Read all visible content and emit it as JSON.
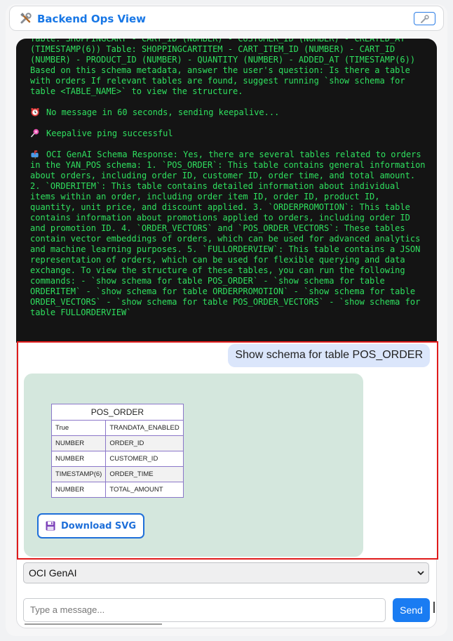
{
  "header": {
    "title": "Backend Ops View",
    "icon": "tools-icon",
    "action_icon": "wrench-icon"
  },
  "terminal": {
    "messages": [
      {
        "icon": "",
        "text": "Table: SHOPPINGCART - CART_ID (NUMBER) - CUSTOMER_ID (NUMBER) - CREATED_AT (TIMESTAMP(6)) Table: SHOPPINGCARTITEM - CART_ITEM_ID (NUMBER) - CART_ID (NUMBER) - PRODUCT_ID (NUMBER) - QUANTITY (NUMBER) - ADDED_AT (TIMESTAMP(6)) Based on this schema metadata, answer the user's question: Is there a table with orders If relevant tables are found, suggest running `show schema for table <TABLE_NAME>` to view the structure."
      },
      {
        "icon": "alarm-clock-icon",
        "text": "No message in 60 seconds, sending keepalive..."
      },
      {
        "icon": "lollipop-icon",
        "text": "Keepalive ping successful"
      },
      {
        "icon": "mailbox-icon",
        "text": "OCI GenAI Schema Response: Yes, there are several tables related to orders in the YAN_POS schema: 1. `POS_ORDER`: This table contains general information about orders, including order ID, customer ID, order time, and total amount. 2. `ORDERITEM`: This table contains detailed information about individual items within an order, including order item ID, order ID, product ID, quantity, unit price, and discount applied. 3. `ORDERPROMOTION`: This table contains information about promotions applied to orders, including order ID and promotion ID. 4. `ORDER_VECTORS` and `POS_ORDER_VECTORS`: These tables contain vector embeddings of orders, which can be used for advanced analytics and machine learning purposes. 5. `FULLORDERVIEW`: This table contains a JSON representation of orders, which can be used for flexible querying and data exchange. To view the structure of these tables, you can run the following commands: - `show schema for table POS_ORDER` - `show schema for table ORDERITEM` - `show schema for table ORDERPROMOTION` - `show schema for table ORDER_VECTORS` - `show schema for table POS_ORDER_VECTORS` - `show schema for table FULLORDERVIEW`"
      }
    ]
  },
  "chat": {
    "user_message": "Show schema for table POS_ORDER",
    "schema": {
      "table_name": "POS_ORDER",
      "rows": [
        {
          "type": "True",
          "name": "TRANDATA_ENABLED"
        },
        {
          "type": "NUMBER",
          "name": "ORDER_ID"
        },
        {
          "type": "NUMBER",
          "name": "CUSTOMER_ID"
        },
        {
          "type": "TIMESTAMP(6)",
          "name": "ORDER_TIME"
        },
        {
          "type": "NUMBER",
          "name": "TOTAL_AMOUNT"
        }
      ]
    },
    "download_label": "Download SVG",
    "download_icon": "floppy-disk-icon"
  },
  "composer": {
    "model_selected": "OCI GenAI",
    "input_placeholder": "Type a message...",
    "input_value": "",
    "send_label": "Send"
  },
  "colors": {
    "accent": "#1a7cf2",
    "terminal_bg": "#141414",
    "terminal_text": "#2fe05f",
    "highlight": "#e01b1b",
    "bot_card": "#d4e7dd",
    "user_bubble": "#dbe6fb",
    "table_border": "#8b77c9"
  }
}
